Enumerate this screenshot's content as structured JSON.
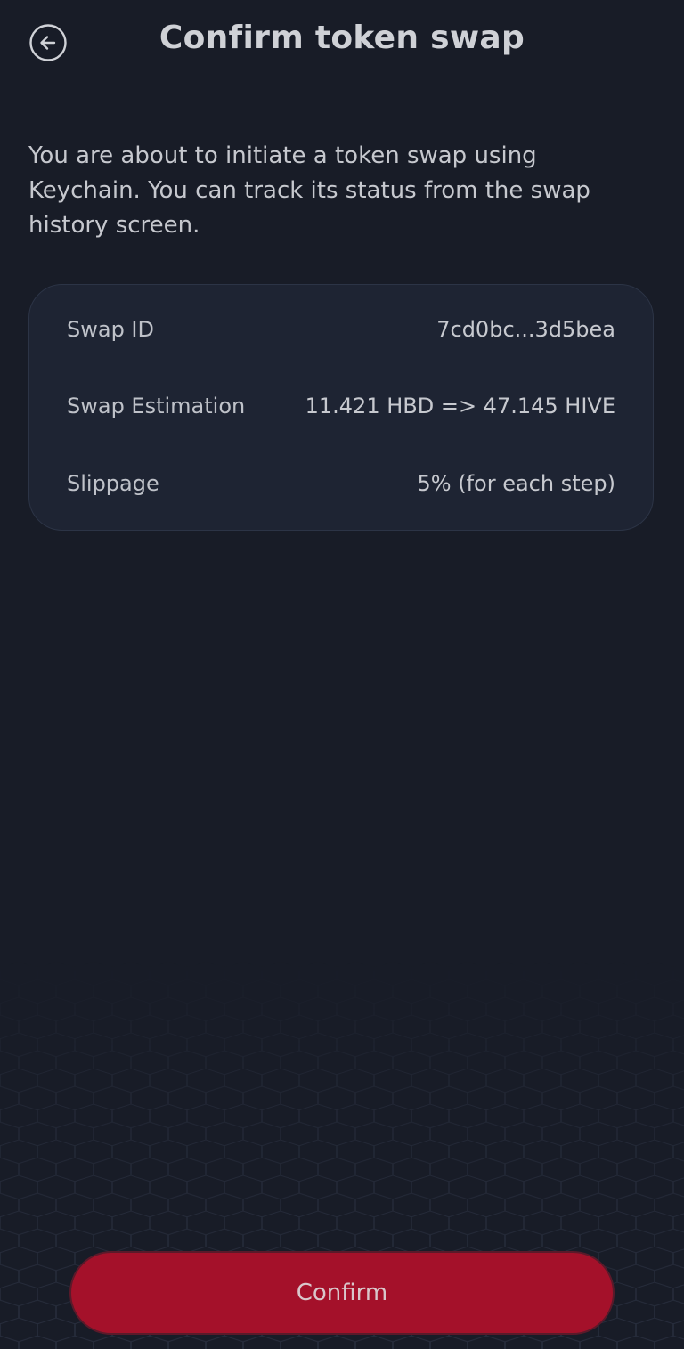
{
  "header": {
    "title": "Confirm token swap",
    "back_icon": "arrow-left-circle-icon"
  },
  "description": "You are about to initiate a token swap using Keychain. You can track its status from the swap history screen.",
  "summary": {
    "rows": [
      {
        "label": "Swap ID",
        "value": "7cd0bc...3d5bea"
      },
      {
        "label": "Swap Estimation",
        "value": "11.421 HBD => 47.145 HIVE"
      },
      {
        "label": "Slippage",
        "value": "5% (for each step)"
      }
    ]
  },
  "footer": {
    "confirm_label": "Confirm"
  },
  "colors": {
    "background": "#181c27",
    "card": "#1e2433",
    "accent": "#a4112a"
  }
}
